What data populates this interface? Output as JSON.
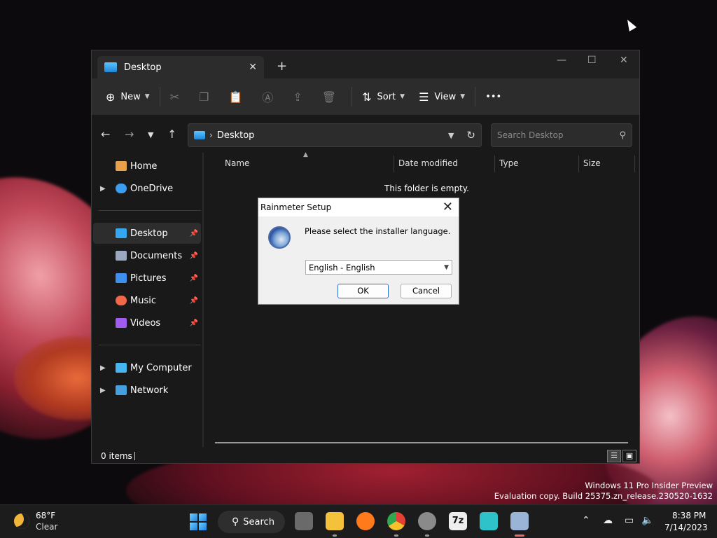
{
  "explorer": {
    "tab_title": "Desktop",
    "tab_close": "✕",
    "new_tab": "+",
    "window_controls": {
      "minimize": "—",
      "maximize": "☐",
      "close": "✕"
    },
    "toolbar": {
      "new_label": "New",
      "sort_label": "Sort",
      "view_label": "View",
      "more_label": "•••"
    },
    "address": {
      "crumb": "Desktop",
      "search_placeholder": "Search Desktop"
    },
    "sidebar": [
      {
        "label": "Home",
        "icon": "home-icon",
        "color": "#e8a04a"
      },
      {
        "label": "OneDrive",
        "icon": "cloud-icon",
        "color": "#3b9cf0"
      },
      {
        "label": "Desktop",
        "icon": "desktop-icon",
        "color": "#35a7f0"
      },
      {
        "label": "Documents",
        "icon": "documents-icon",
        "color": "#9aa8c0"
      },
      {
        "label": "Pictures",
        "icon": "pictures-icon",
        "color": "#3f8ff0"
      },
      {
        "label": "Music",
        "icon": "music-icon",
        "color": "#f0684a"
      },
      {
        "label": "Videos",
        "icon": "videos-icon",
        "color": "#a05cf0"
      },
      {
        "label": "My Computer",
        "icon": "computer-icon",
        "color": "#46b6f0"
      },
      {
        "label": "Network",
        "icon": "network-icon",
        "color": "#46a0e0"
      }
    ],
    "columns": [
      "Name",
      "Date modified",
      "Type",
      "Size"
    ],
    "empty_message": "This folder is empty.",
    "status_count": "0 items"
  },
  "dialog": {
    "title": "Rainmeter Setup",
    "close": "✕",
    "message": "Please select the installer language.",
    "selected_language": "English - English",
    "ok_label": "OK",
    "cancel_label": "Cancel"
  },
  "watermark": {
    "line1": "Windows 11 Pro Insider Preview",
    "line2": "Evaluation copy. Build 25375.zn_release.230520-1632"
  },
  "taskbar": {
    "weather_temp": "68°F",
    "weather_cond": "Clear",
    "search_label": "Search",
    "clock_time": "8:38 PM",
    "clock_date": "7/14/2023",
    "sevenzip_label": "7z"
  }
}
